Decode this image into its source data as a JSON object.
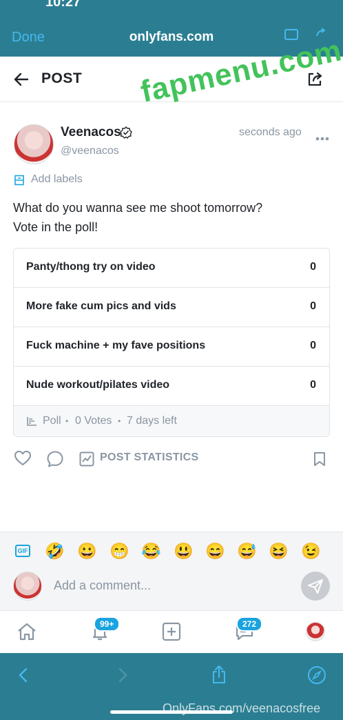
{
  "browser": {
    "status_time": "10:27",
    "done_label": "Done",
    "url": "onlyfans.com"
  },
  "header": {
    "title": "POST"
  },
  "watermark": "fapmenu.com",
  "post": {
    "author_name": "Veenacos",
    "author_handle": "@veenacos",
    "time": "seconds ago",
    "add_labels": "Add labels",
    "text_line1": "What do you wanna see me shoot tomorrow?",
    "text_line2": "Vote in the poll!"
  },
  "poll": {
    "options": [
      {
        "label": "Panty/thong try on video",
        "count": "0"
      },
      {
        "label": "More fake cum pics and vids",
        "count": "0"
      },
      {
        "label": "Fuck machine + my fave positions",
        "count": "0"
      },
      {
        "label": "Nude workout/pilates video",
        "count": "0"
      }
    ],
    "footer": {
      "type": "Poll",
      "votes": "0 Votes",
      "time_left": "7 days left",
      "separator": "•"
    }
  },
  "actions": {
    "post_statistics": "POST STATISTICS"
  },
  "emojis": [
    "🤣",
    "😀",
    "😁",
    "😂",
    "😃",
    "😄",
    "😅",
    "😆",
    "😉"
  ],
  "comment": {
    "placeholder": "Add a comment..."
  },
  "nav": {
    "notifications_badge": "99+",
    "messages_badge": "272"
  },
  "footer_watermark": "OnlyFans.com/veenacosfree",
  "colors": {
    "safari_bar": "#2b7e92",
    "accent": "#1aa3e0",
    "muted_text": "#8a96a3",
    "watermark": "#43c35a"
  }
}
